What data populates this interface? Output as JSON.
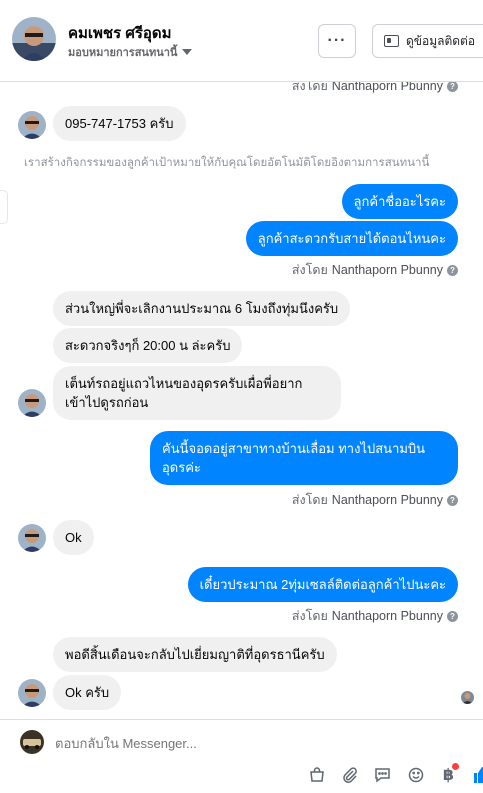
{
  "header": {
    "name": "คมเพชร ศรีอุดม",
    "assignment": "มอบหมายการสนทนานี้",
    "more_label": "···",
    "contact_label": "ดูข้อมูลติดต่อ"
  },
  "sent_by": {
    "prefix": "ส่งโดย",
    "name": "Nanthaporn Pbunny"
  },
  "messages": {
    "phone": "095-747-1753 ครับ",
    "system_note": "เราสร้างกิจกรรมของลูกค้าเป้าหมายให้กับคุณโดยอัตโนมัติโดยอิงตามการสนทนานี้",
    "out1": "ลูกค้าชื่ออะไรคะ",
    "out2": "ลูกค้าสะดวกรับสายได้ตอนไหนคะ",
    "in1": "ส่วนใหญ่พี่จะเลิกงานประมาณ 6 โมงถึงทุ่มนึงครับ",
    "in2": "สะดวกจริงๆก็ 20:00 น ล่ะครับ",
    "in3": "เต็นท์รถอยู่แถวไหนของอุดรครับเผื่อพี่อยาก เข้าไปดูรถก่อน",
    "out3": "คันนี้จอดอยู่สาขาทางบ้านเลื่อม ทางไปสนามบิน อุดรค่ะ",
    "in4": "Ok",
    "out4": "เดี๋ยวประมาณ 2ทุ่มเซลล์ติดต่อลูกค้าไปนะคะ",
    "in5": "พอดีสิ้นเดือนจะกลับไปเยี่ยมญาติที่อุดรธานีครับ",
    "in6": "Ok ครับ"
  },
  "composer": {
    "placeholder": "ตอบกลับใน Messenger..."
  },
  "colors": {
    "outgoing_bubble": "#0084ff",
    "incoming_bubble": "#f0f0f0",
    "like_icon": "#0084ff"
  }
}
